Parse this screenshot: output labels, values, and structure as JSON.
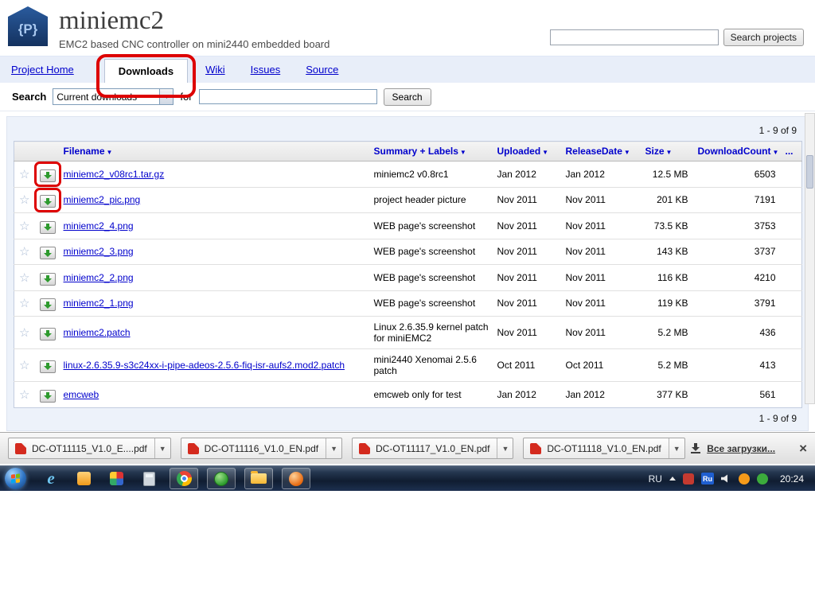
{
  "header": {
    "logo_text": "{P}",
    "title": "miniemc2",
    "subtitle": "EMC2 based CNC controller on mini2440 embedded board",
    "search_button": "Search projects"
  },
  "nav": {
    "tabs": [
      {
        "label": "Project Home"
      },
      {
        "label": "Downloads"
      },
      {
        "label": "Wiki"
      },
      {
        "label": "Issues"
      },
      {
        "label": "Source"
      }
    ]
  },
  "search_bar": {
    "label": "Search",
    "scope_value": "Current downloads",
    "for_label": "for",
    "button": "Search"
  },
  "table": {
    "pagination": "1 - 9 of 9",
    "columns": [
      "Filename",
      "Summary + Labels",
      "Uploaded",
      "ReleaseDate",
      "Size",
      "DownloadCount",
      "..."
    ],
    "rows": [
      {
        "filename": "miniemc2_v08rc1.tar.gz",
        "summary": "miniemc2 v0.8rc1",
        "uploaded": "Jan 2012",
        "release": "Jan 2012",
        "size": "12.5 MB",
        "count": "6503",
        "ring": true
      },
      {
        "filename": "miniemc2_pic.png",
        "summary": "project header picture",
        "uploaded": "Nov 2011",
        "release": "Nov 2011",
        "size": "201 KB",
        "count": "7191",
        "ring": true
      },
      {
        "filename": "miniemc2_4.png",
        "summary": "WEB page's screenshot",
        "uploaded": "Nov 2011",
        "release": "Nov 2011",
        "size": "73.5 KB",
        "count": "3753",
        "ring": false
      },
      {
        "filename": "miniemc2_3.png",
        "summary": "WEB page's screenshot",
        "uploaded": "Nov 2011",
        "release": "Nov 2011",
        "size": "143 KB",
        "count": "3737",
        "ring": false
      },
      {
        "filename": "miniemc2_2.png",
        "summary": "WEB page's screenshot",
        "uploaded": "Nov 2011",
        "release": "Nov 2011",
        "size": "116 KB",
        "count": "4210",
        "ring": false
      },
      {
        "filename": "miniemc2_1.png",
        "summary": "WEB page's screenshot",
        "uploaded": "Nov 2011",
        "release": "Nov 2011",
        "size": "119 KB",
        "count": "3791",
        "ring": false
      },
      {
        "filename": "miniemc2.patch",
        "summary": "Linux 2.6.35.9 kernel patch for miniEMC2",
        "uploaded": "Nov 2011",
        "release": "Nov 2011",
        "size": "5.2 MB",
        "count": "436",
        "ring": false
      },
      {
        "filename": "linux-2.6.35.9-s3c24xx-i-pipe-adeos-2.5.6-fiq-isr-aufs2.mod2.patch",
        "summary": "mini2440 Xenomai 2.5.6 patch",
        "uploaded": "Oct 2011",
        "release": "Oct 2011",
        "size": "5.2 MB",
        "count": "413",
        "ring": false
      },
      {
        "filename": "emcweb",
        "summary": "emcweb only for test",
        "uploaded": "Jan 2012",
        "release": "Jan 2012",
        "size": "377 KB",
        "count": "561",
        "ring": false
      }
    ]
  },
  "download_bar": {
    "items": [
      "DC-OT11115_V1.0_E....pdf",
      "DC-OT11116_V1.0_EN.pdf",
      "DC-OT11117_V1.0_EN.pdf",
      "DC-OT11118_V1.0_EN.pdf"
    ],
    "show_all_label": "Все загрузки..."
  },
  "taskbar": {
    "language": "RU",
    "ru_badge": "Ru",
    "time": "20:24"
  }
}
